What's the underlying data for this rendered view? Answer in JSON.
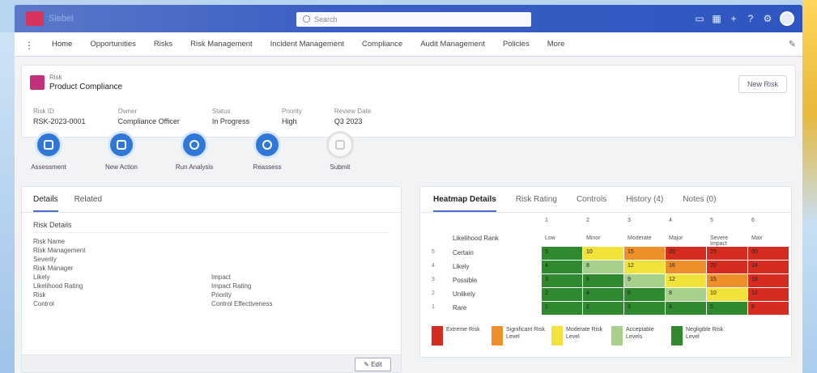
{
  "header": {
    "app_title": "Siebel",
    "search_placeholder": "Search",
    "icons": [
      "recent-items-icon",
      "favorites-icon",
      "add-icon",
      "help-icon",
      "settings-icon",
      "user-avatar"
    ]
  },
  "nav": {
    "items": [
      "Home",
      "Opportunities",
      "Risks",
      "Risk Management",
      "Incident Management",
      "Compliance",
      "Audit Management",
      "Policies",
      "More"
    ],
    "edit_icon": "edit-pencil-icon"
  },
  "record": {
    "type": "Risk",
    "name": "Product Compliance",
    "button_label": "New Risk",
    "fields": [
      {
        "label": "Risk ID",
        "value": "RSK-2023-0001"
      },
      {
        "label": "Owner",
        "value": "Compliance Officer"
      },
      {
        "label": "Status",
        "value": "In Progress"
      },
      {
        "label": "Priority",
        "value": "High"
      },
      {
        "label": "Review Date",
        "value": "Q3 2023"
      }
    ]
  },
  "actions": [
    {
      "label": "Assessment",
      "enabled": true
    },
    {
      "label": "New Action",
      "enabled": true
    },
    {
      "label": "Run Analysis",
      "enabled": true
    },
    {
      "label": "Reassess",
      "enabled": true
    },
    {
      "label": "Submit",
      "enabled": false
    }
  ],
  "details": {
    "tabs": [
      "Details",
      "Related"
    ],
    "section": "Risk Details",
    "rows": [
      {
        "left": "Risk Name",
        "right": ""
      },
      {
        "left": "Risk Management",
        "right": ""
      },
      {
        "left": "Severity",
        "right": ""
      },
      {
        "left": "Risk Manager",
        "right": ""
      },
      {
        "left": "Likely",
        "right": "Impact"
      },
      {
        "left": "Likelihood Rating",
        "right": "Impact Rating"
      },
      {
        "left": "Risk",
        "right": "Priority"
      },
      {
        "left": "Control",
        "right": "Control Effectiveness"
      }
    ],
    "edit_label": "Edit"
  },
  "heatmap": {
    "tabs": [
      "Heatmap Details",
      "Risk Rating",
      "Controls",
      "History (4)",
      "Notes (0)"
    ],
    "top_numbers": [
      "1",
      "2",
      "3",
      "4",
      "5",
      "6"
    ],
    "columns": [
      "Low",
      "Minor",
      "Moderate",
      "Major",
      "Severe Impact",
      "Max"
    ],
    "row_header": "Likelihood Rank",
    "rows": [
      {
        "idx": "5",
        "label": "Certain"
      },
      {
        "idx": "4",
        "label": "Likely"
      },
      {
        "idx": "3",
        "label": "Possible"
      },
      {
        "idx": "2",
        "label": "Unlikely"
      },
      {
        "idx": "1",
        "label": "Rare"
      }
    ],
    "cells": [
      [
        "5",
        "10",
        "15",
        "20",
        "25",
        "30"
      ],
      [
        "4",
        "8",
        "12",
        "16",
        "20",
        "24"
      ],
      [
        "3",
        "6",
        "9",
        "12",
        "15",
        "18"
      ],
      [
        "2",
        "4",
        "6",
        "8",
        "10",
        "12"
      ],
      [
        "1",
        "2",
        "3",
        "4",
        "5",
        "6"
      ]
    ],
    "colors": {
      "red": "#d62c20",
      "orange": "#ee8f2a",
      "yellow": "#f2e23a",
      "lightgreen": "#a8d08d",
      "green": "#2f8a2f"
    },
    "cell_colors": [
      [
        "green",
        "yellow",
        "orange",
        "red",
        "red",
        "red"
      ],
      [
        "green",
        "lightgreen",
        "yellow",
        "orange",
        "red",
        "red"
      ],
      [
        "green",
        "green",
        "lightgreen",
        "yellow",
        "orange",
        "red"
      ],
      [
        "green",
        "green",
        "green",
        "lightgreen",
        "yellow",
        "red"
      ],
      [
        "green",
        "green",
        "green",
        "green",
        "green",
        "red"
      ]
    ],
    "legend": [
      {
        "color": "red",
        "label": "Extreme Risk"
      },
      {
        "color": "orange",
        "label": "Significant Risk Level"
      },
      {
        "color": "yellow",
        "label": "Moderate Risk Level"
      },
      {
        "color": "lightgreen",
        "label": "Acceptable Levels"
      },
      {
        "color": "green",
        "label": "Negligible Risk Level"
      }
    ]
  }
}
